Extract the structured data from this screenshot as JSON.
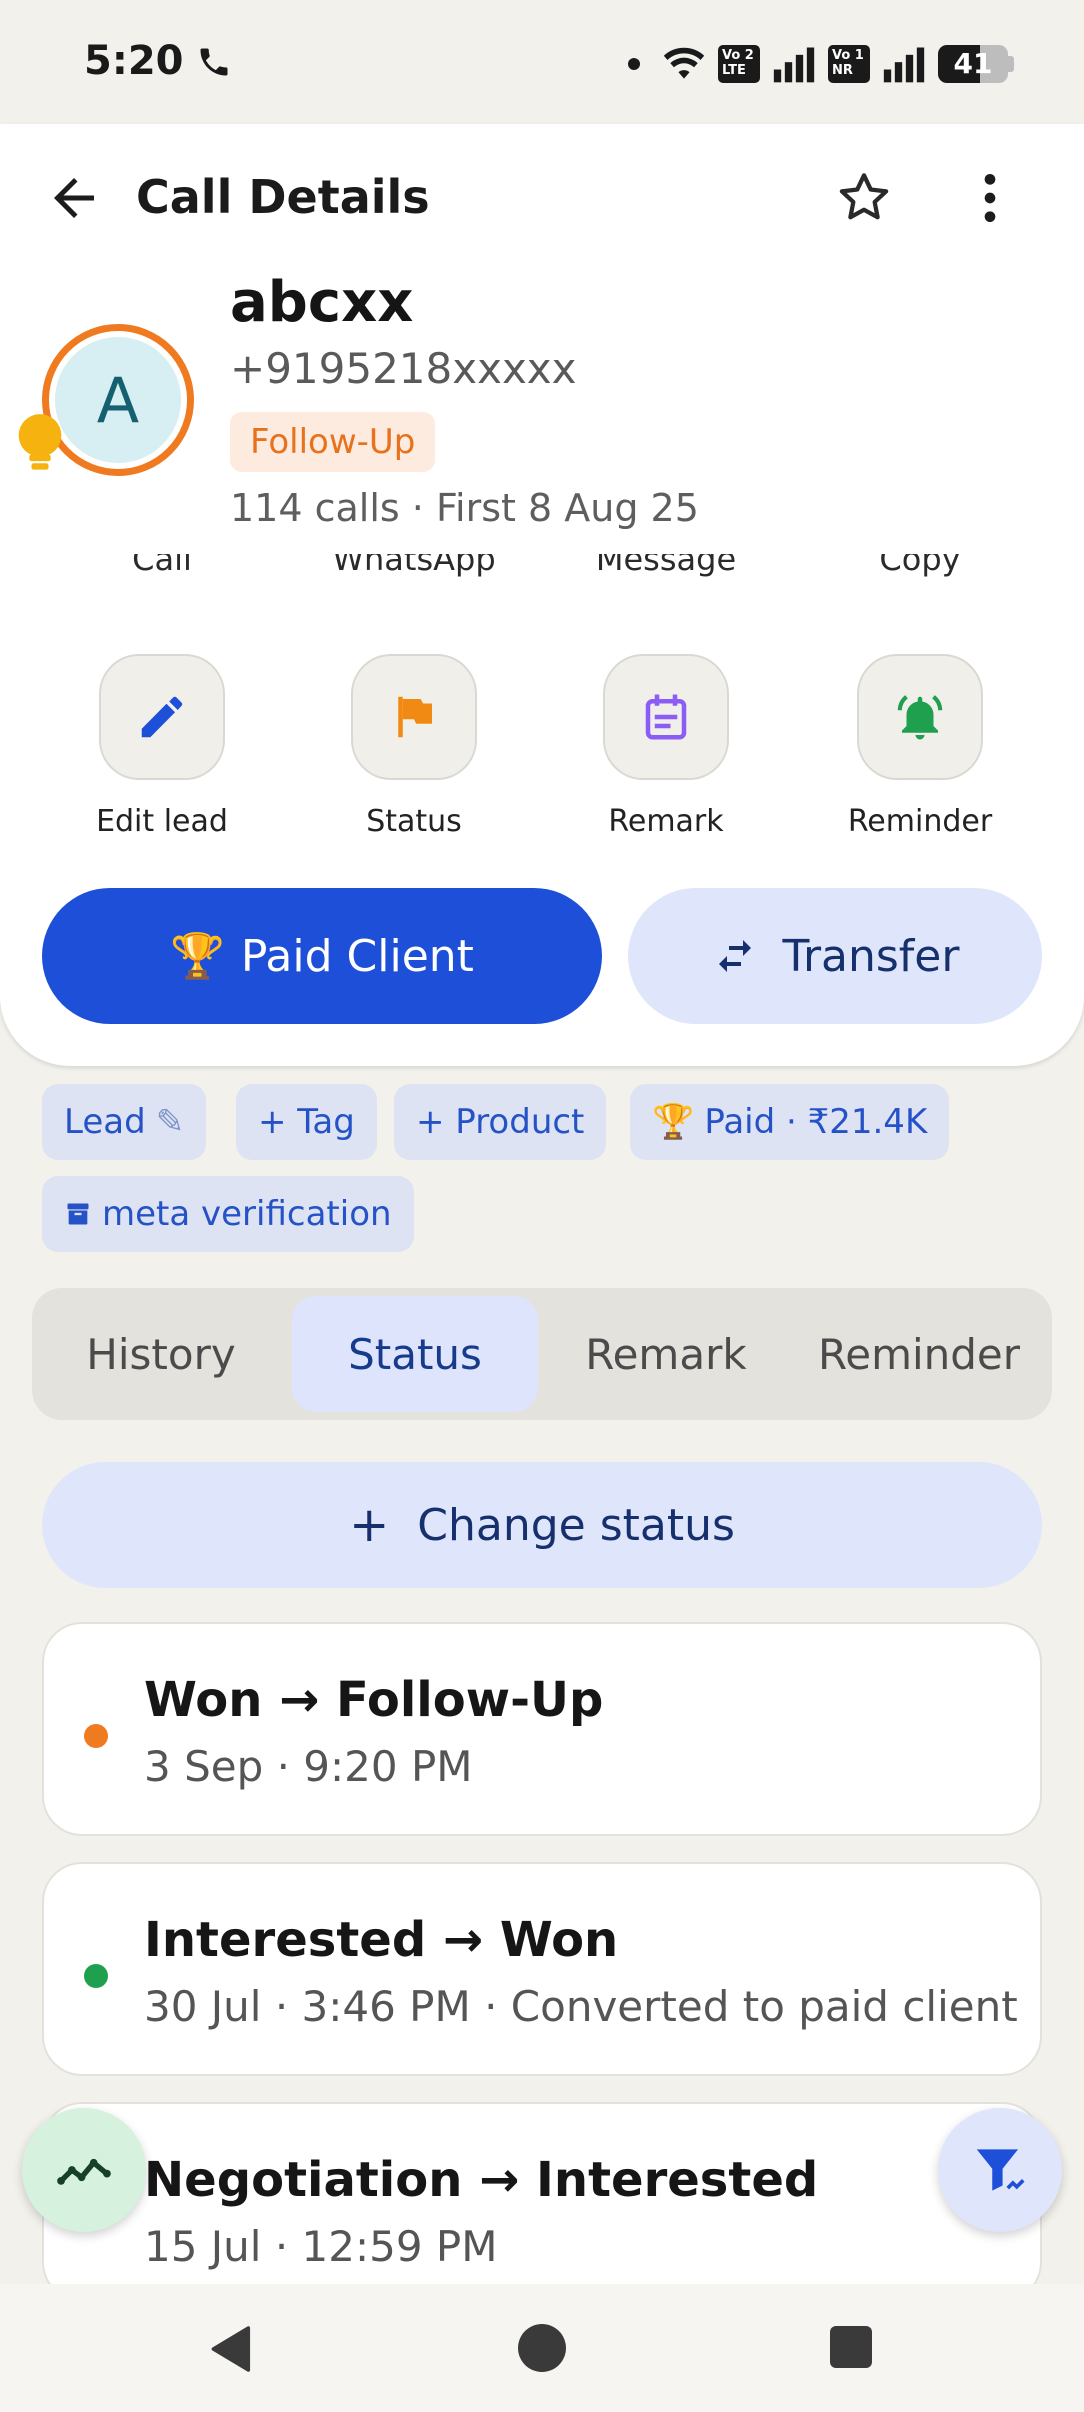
{
  "status_bar": {
    "time": "5:20",
    "sim1": "Vo 2 LTE",
    "sim2": "Vo 1 NR",
    "battery": "41"
  },
  "header": {
    "title": "Call Details"
  },
  "contact": {
    "initial": "A",
    "name": "abcxx",
    "phone": "+9195218xxxxx",
    "status": "Follow-Up",
    "summary": "114 calls · First 8 Aug 25"
  },
  "quick_actions_peek": [
    "Call",
    "WhatsApp",
    "Message",
    "Copy"
  ],
  "actions": [
    {
      "label": "Edit lead",
      "icon": "pencil-icon"
    },
    {
      "label": "Status",
      "icon": "flag-icon"
    },
    {
      "label": "Remark",
      "icon": "note-icon"
    },
    {
      "label": "Reminder",
      "icon": "bell-icon"
    }
  ],
  "primary_buttons": {
    "paid_client": "Paid Client",
    "transfer": "Transfer"
  },
  "chips": {
    "lead": "Lead",
    "tag": "+ Tag",
    "product": "+ Product",
    "paid": "Paid · ₹21.4K",
    "meta": "meta verification"
  },
  "tabs": [
    "History",
    "Status",
    "Remark",
    "Reminder"
  ],
  "active_tab": "Status",
  "change_status_label": "Change status",
  "history": [
    {
      "title": "Won → Follow-Up",
      "meta": "3 Sep · 9:20 PM",
      "color": "#f07a1f"
    },
    {
      "title": "Interested → Won",
      "meta": "30 Jul · 3:46 PM · Converted to paid client",
      "color": "#1ea04f"
    },
    {
      "title": "Negotiation → Interested",
      "meta": "15 Jul · 12:59 PM",
      "color": "#1ea04f"
    }
  ],
  "colors": {
    "primary": "#1d4fd8",
    "accent_orange": "#f07a1f",
    "light_blue": "#dfe6fb"
  }
}
